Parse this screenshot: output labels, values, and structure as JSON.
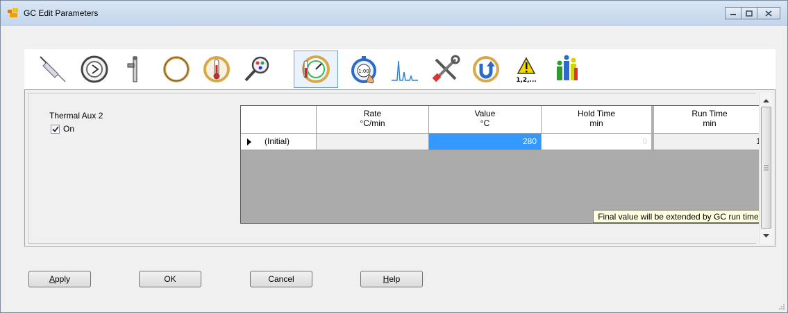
{
  "window": {
    "title": "GC Edit Parameters",
    "buttons": {
      "minimize": "▭",
      "maximize": "▢",
      "close": "✕"
    }
  },
  "toolbar": {
    "items": [
      {
        "name": "syringe-icon",
        "selected": false
      },
      {
        "name": "inlet-ring-icon",
        "selected": false
      },
      {
        "name": "column-valve-icon",
        "selected": false
      },
      {
        "name": "column-oven-ring-icon",
        "selected": false
      },
      {
        "name": "oven-thermometer-icon",
        "selected": false
      },
      {
        "name": "detector-magnifier-icon",
        "selected": false
      },
      {
        "name": "thermal-aux-gauge-icon",
        "selected": true
      },
      {
        "name": "stopwatch-timer-icon",
        "selected": false
      },
      {
        "name": "chromatogram-signal-icon",
        "selected": false
      },
      {
        "name": "configuration-tools-icon",
        "selected": false
      },
      {
        "name": "backflush-arrow-icon",
        "selected": false
      },
      {
        "name": "warning-sequence-icon",
        "selected": false,
        "label": "1,2,..."
      },
      {
        "name": "bar-people-icon",
        "selected": false
      }
    ]
  },
  "aux": {
    "title": "Thermal Aux 2",
    "on_label": "On",
    "on_checked": true
  },
  "table": {
    "columns": [
      {
        "label": "Rate",
        "unit": "°C/min"
      },
      {
        "label": "Value",
        "unit": "°C"
      },
      {
        "label": "Hold Time",
        "unit": "min"
      },
      {
        "label": "Run Time",
        "unit": "min"
      }
    ],
    "rows": [
      {
        "label": "(Initial)",
        "rate": "",
        "value": "280",
        "hold_time": "0",
        "run_time": "1"
      }
    ],
    "note": "Final value will be extended by GC run time."
  },
  "buttons": {
    "apply": {
      "label": "pply",
      "mnemonic": "A"
    },
    "ok": {
      "label": "OK"
    },
    "cancel": {
      "label": "Cancel"
    },
    "help": {
      "label": "elp",
      "mnemonic": "H"
    }
  },
  "colors": {
    "selected_cell": "#3399ff",
    "tooltip": "#ffffe1",
    "warning": "#f5d800"
  }
}
